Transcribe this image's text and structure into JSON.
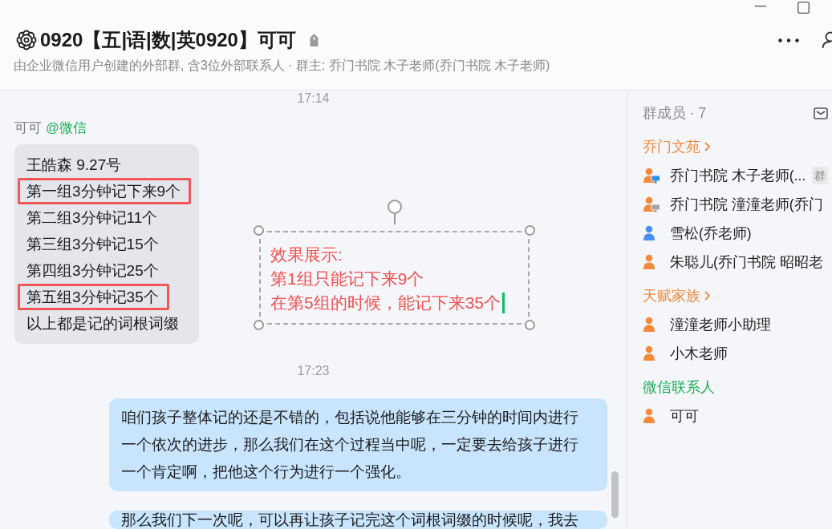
{
  "window": {
    "title": "0920【五|语|数|英0920】可可",
    "subtitle": "由企业微信用户创建的外部群, 含3位外部联系人 · 群主: 乔门书院 木子老师(乔门书院 木子老师)"
  },
  "chat": {
    "messages": [
      {
        "kind": "time",
        "text": "17:14"
      },
      {
        "kind": "incoming",
        "sender": "可可",
        "source": "@微信",
        "lines": [
          {
            "text": "王皓森 9.27号",
            "highlighted": false
          },
          {
            "text": "第一组3分钟记下来9个",
            "highlighted": true
          },
          {
            "text": "第二组3分钟记11个",
            "highlighted": false
          },
          {
            "text": "第三组3分钟记15个",
            "highlighted": false
          },
          {
            "text": "第四组3分钟记25个",
            "highlighted": false
          },
          {
            "text": "第五组3分钟记35个",
            "highlighted": true
          },
          {
            "text": "以上都是记的词根词缀",
            "highlighted": false
          }
        ]
      },
      {
        "kind": "time",
        "text": "17:23"
      },
      {
        "kind": "outgoing",
        "text": "咱们孩子整体记的还是不错的，包括说他能够在三分钟的时间内进行一个依次的进步，那么我们在这个过程当中呢，一定要去给孩子进行一个肯定啊，把他这个行为进行一个强化。"
      },
      {
        "kind": "outgoing",
        "text": "那么我们下一次呢，可以再让孩子记完这个词根词缀的时候呢，我去"
      }
    ]
  },
  "annotation": {
    "lines": [
      "效果展示:",
      "第1组只能记下来9个",
      "在第5组的时候，能记下来35个"
    ],
    "editing": true
  },
  "members": {
    "title": "群成员 · 7",
    "groups": [
      {
        "name": "乔门文苑",
        "kind": "corp",
        "members": [
          {
            "name": "乔门书院 木子老师(...",
            "color": "#f5893b",
            "pc_online": true,
            "badge": "群"
          },
          {
            "name": "乔门书院 潼潼老师(乔门",
            "color": "#f5893b",
            "pc_online": false
          },
          {
            "name": "雪松(乔老师)",
            "color": "#4a8ff0"
          },
          {
            "name": "朱聪儿(乔门书院 昭昭老",
            "color": "#f5893b"
          }
        ]
      },
      {
        "name": "天赋家族",
        "kind": "corp",
        "members": [
          {
            "name": "潼潼老师小助理",
            "color": "#f5893b"
          },
          {
            "name": "小木老师",
            "color": "#f5893b"
          }
        ]
      },
      {
        "name": "微信联系人",
        "kind": "wechat",
        "members": [
          {
            "name": "可可",
            "color": "#f5893b"
          }
        ]
      }
    ]
  }
}
